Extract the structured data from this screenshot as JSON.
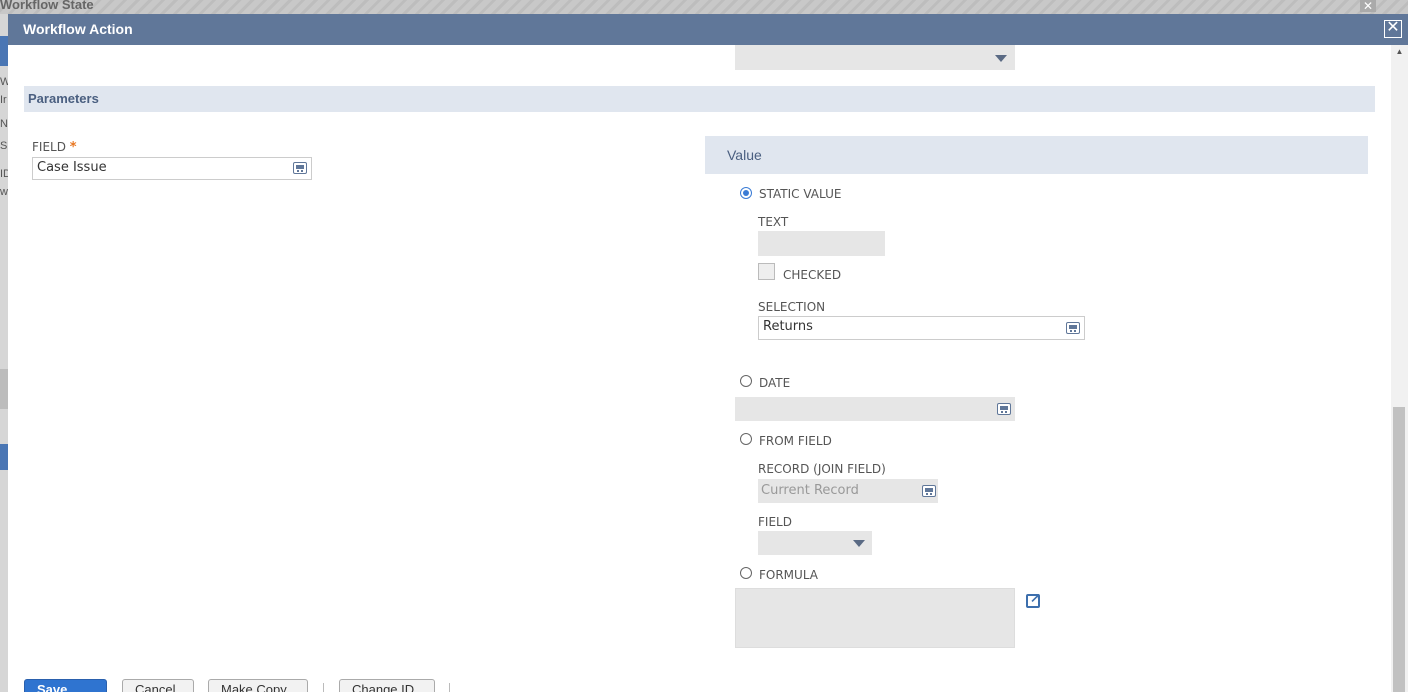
{
  "background": {
    "title": "Workflow State",
    "side_letters": [
      "W",
      "Ir",
      "N",
      "S",
      "ID",
      "w"
    ]
  },
  "dialog": {
    "title": "Workflow Action",
    "close_symbol": "✕"
  },
  "parameters": {
    "section_title": "Parameters",
    "field_label": "FIELD",
    "required_mark": "*",
    "field_value": "Case Issue"
  },
  "value_panel": {
    "title": "Value",
    "static_value": {
      "label": "STATIC VALUE",
      "selected": true,
      "text_label": "TEXT",
      "text_value": "",
      "checked_label": "CHECKED",
      "checked": false,
      "selection_label": "SELECTION",
      "selection_value": "Returns"
    },
    "date": {
      "label": "DATE",
      "selected": false,
      "value": ""
    },
    "from_field": {
      "label": "FROM FIELD",
      "selected": false,
      "record_label": "RECORD (JOIN FIELD)",
      "record_placeholder": "Current Record",
      "field_label": "FIELD",
      "field_value": ""
    },
    "formula": {
      "label": "FORMULA",
      "selected": false,
      "value": ""
    }
  },
  "buttons": {
    "save": "Save",
    "cancel": "Cancel",
    "make_copy": "Make Copy",
    "change_id": "Change ID"
  },
  "colors": {
    "header": "#607799",
    "section_bg": "#e0e6ef",
    "accent": "#3a7bd5",
    "required": "#e87722"
  }
}
